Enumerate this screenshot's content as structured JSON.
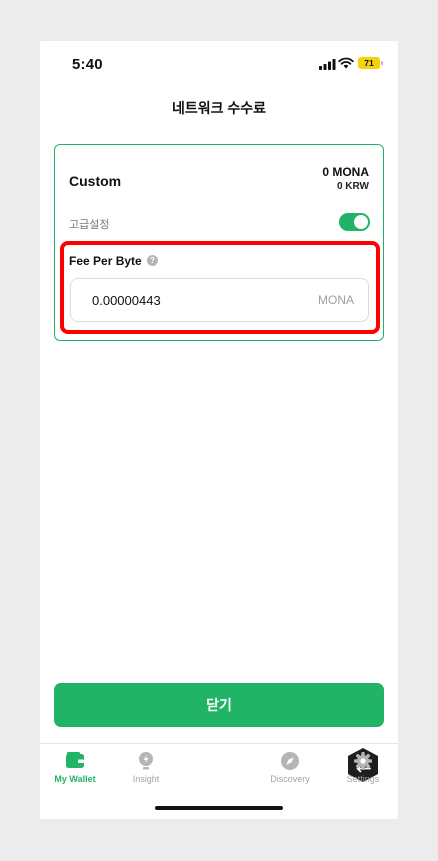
{
  "status": {
    "time": "5:40",
    "battery": "71"
  },
  "header": {
    "title": "네트워크 수수료"
  },
  "fee_card": {
    "name": "Custom",
    "amount": "0 MONA",
    "fiat": "0 KRW",
    "advanced_label": "고급설정",
    "advanced_enabled": true,
    "fee_per_byte_label": "Fee Per Byte",
    "fee_value": "0.00000443",
    "fee_unit": "MONA"
  },
  "close_button": {
    "label": "닫기"
  },
  "tabbar": {
    "items": [
      {
        "label": "My Wallet",
        "icon": "wallet-icon",
        "active": true
      },
      {
        "label": "Insight",
        "icon": "bulb-icon",
        "active": false
      },
      {
        "label": "",
        "icon": "swap-icon",
        "active": false
      },
      {
        "label": "Discovery",
        "icon": "compass-icon",
        "active": false
      },
      {
        "label": "Settings",
        "icon": "gear-icon",
        "active": false
      }
    ]
  },
  "colors": {
    "accent": "#21b366",
    "highlight": "#ff0000"
  }
}
